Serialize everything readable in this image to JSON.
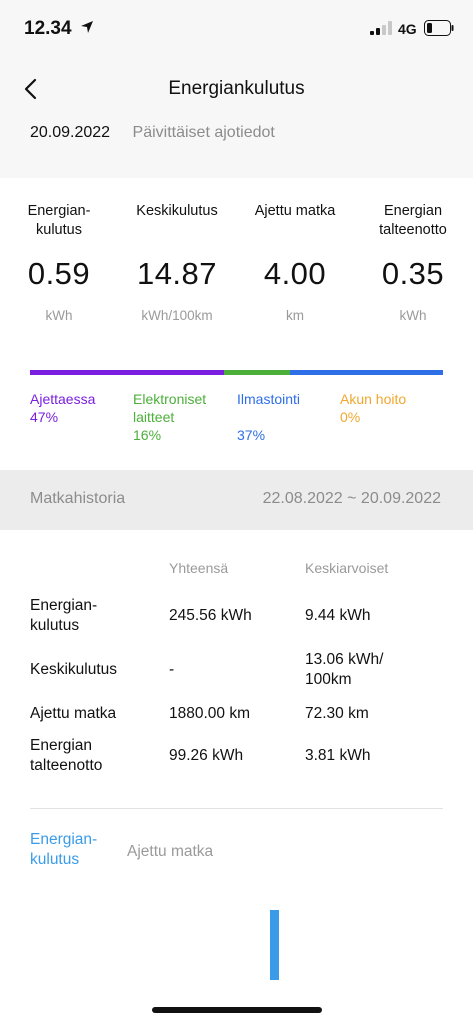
{
  "status_bar": {
    "time": "12.34",
    "network": "4G"
  },
  "nav": {
    "title": "Energiankulutus"
  },
  "date_row": {
    "date": "20.09.2022",
    "subtitle": "Päivittäiset ajotiedot"
  },
  "summary": {
    "stats": [
      {
        "label": "Energian-\nkulutus",
        "value": "0.59",
        "unit": "kWh"
      },
      {
        "label": "Keskikulutus",
        "value": "14.87",
        "unit": "kWh/100km"
      },
      {
        "label": "Ajettu matka",
        "value": "4.00",
        "unit": "km"
      },
      {
        "label": "Energian\ntalteenotto",
        "value": "0.35",
        "unit": "kWh"
      }
    ],
    "breakdown": [
      {
        "label": "Ajettaessa",
        "percent": "47%",
        "share": 47,
        "color": "#7a1fe0"
      },
      {
        "label": "Elektroniset\nlaitteet",
        "percent": "16%",
        "share": 16,
        "color": "#4caf3a"
      },
      {
        "label": "Ilmastointi",
        "percent": "37%",
        "share": 37,
        "color": "#2e6ee6"
      },
      {
        "label": "Akun hoito",
        "percent": "0%",
        "share": 0,
        "color": "#f0a830"
      }
    ]
  },
  "history": {
    "title": "Matkahistoria",
    "range": "22.08.2022 ~ 20.09.2022",
    "col_total": "Yhteensä",
    "col_avg": "Keskiarvoiset",
    "rows": [
      {
        "label": "Energian-\nkulutus",
        "total": "245.56 kWh",
        "avg": "9.44 kWh"
      },
      {
        "label": "Keskikulutus",
        "total": "-",
        "avg": "13.06 kWh/\n100km"
      },
      {
        "label": "Ajettu matka",
        "total": "1880.00 km",
        "avg": "72.30 km"
      },
      {
        "label": "Energian\ntalteenotto",
        "total": "99.26 kWh",
        "avg": "3.81 kWh"
      }
    ],
    "tabs": [
      {
        "label": "Energian-\nkulutus",
        "active": true
      },
      {
        "label": "Ajettu matka",
        "active": false
      }
    ]
  },
  "colors": {
    "accent": "#3a9be8",
    "inactive_tab": "#9a9a9a"
  }
}
